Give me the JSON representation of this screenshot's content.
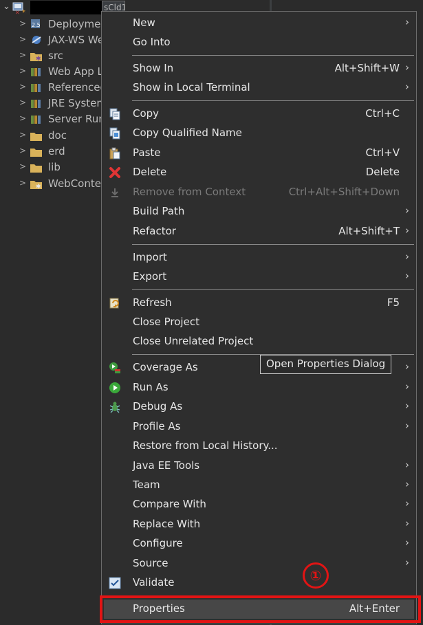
{
  "explorer": {
    "root_name_tail": "sCld1",
    "items": [
      {
        "label": "Deploymer",
        "icon": "deployment-descriptor-icon"
      },
      {
        "label": "JAX-WS We",
        "icon": "web-services-icon"
      },
      {
        "label": "src",
        "icon": "source-folder-icon"
      },
      {
        "label": "Web App L",
        "icon": "library-icon"
      },
      {
        "label": "Referenced",
        "icon": "library-icon"
      },
      {
        "label": "JRE System",
        "icon": "library-icon"
      },
      {
        "label": "Server Runt",
        "icon": "library-icon"
      },
      {
        "label": "doc",
        "icon": "folder-icon"
      },
      {
        "label": "erd",
        "icon": "folder-icon"
      },
      {
        "label": "lib",
        "icon": "folder-icon"
      },
      {
        "label": "WebConter",
        "icon": "folder-icon"
      }
    ]
  },
  "menu": {
    "new": "New",
    "go_into": "Go Into",
    "show_in": "Show In",
    "show_in_shortcut": "Alt+Shift+W",
    "show_in_local_terminal": "Show in Local Terminal",
    "copy": "Copy",
    "copy_shortcut": "Ctrl+C",
    "copy_qualified_name": "Copy Qualified Name",
    "paste": "Paste",
    "paste_shortcut": "Ctrl+V",
    "delete": "Delete",
    "delete_shortcut": "Delete",
    "remove_from_context": "Remove from Context",
    "remove_from_context_shortcut": "Ctrl+Alt+Shift+Down",
    "build_path": "Build Path",
    "refactor": "Refactor",
    "refactor_shortcut": "Alt+Shift+T",
    "import": "Import",
    "export": "Export",
    "refresh": "Refresh",
    "refresh_shortcut": "F5",
    "close_project": "Close Project",
    "close_unrelated_project": "Close Unrelated Project",
    "coverage_as": "Coverage As",
    "run_as": "Run As",
    "debug_as": "Debug As",
    "profile_as": "Profile As",
    "restore_from_local_history": "Restore from Local History...",
    "java_ee_tools": "Java EE Tools",
    "team": "Team",
    "compare_with": "Compare With",
    "replace_with": "Replace With",
    "configure": "Configure",
    "source": "Source",
    "validate": "Validate",
    "properties": "Properties",
    "properties_shortcut": "Alt+Enter"
  },
  "tooltip": "Open Properties Dialog",
  "annotation": {
    "marker": "①",
    "color": "#e21414"
  }
}
